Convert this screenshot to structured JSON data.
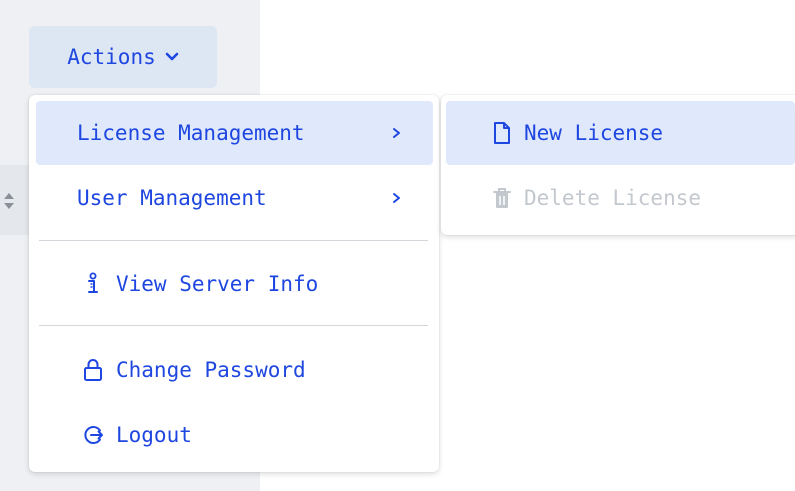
{
  "actions_button": {
    "label": "Actions",
    "icon": "chevron-down-icon"
  },
  "menu": {
    "items": [
      {
        "label": "License Management",
        "has_submenu": true,
        "icon": "chevron-right-icon",
        "active": true
      },
      {
        "label": "User Management",
        "has_submenu": true,
        "icon": "chevron-right-icon"
      },
      {
        "label": "View Server Info",
        "icon": "info-icon"
      },
      {
        "label": "Change Password",
        "icon": "lock-icon"
      },
      {
        "label": "Logout",
        "icon": "logout-icon"
      }
    ]
  },
  "submenu": {
    "items": [
      {
        "label": "New License",
        "icon": "file-icon",
        "active": true
      },
      {
        "label": "Delete License",
        "icon": "trash-icon",
        "disabled": true
      }
    ]
  },
  "colors": {
    "accent": "#1e46e0",
    "active_bg": "#e0e9fb",
    "button_bg": "#dde6f3",
    "disabled": "#c3c8cf"
  }
}
